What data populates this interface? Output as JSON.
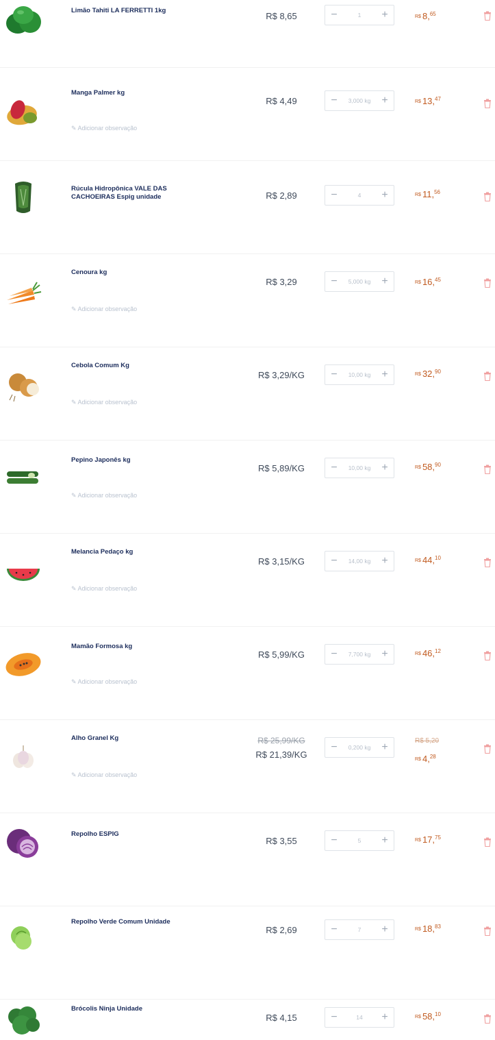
{
  "colors": {
    "accent": "#c15a1f",
    "product_name": "#1b2c5b",
    "muted": "#b9c2cf",
    "trash": "#f0a0a0"
  },
  "note_label": "Adicionar observação",
  "items": [
    {
      "name": "Limão Tahiti LA FERRETTI 1kg",
      "price": "R$ 8,65",
      "qty": "1",
      "total_symbol": "R$",
      "total_int": "8",
      "total_cents": "65",
      "icon": "lime-icon",
      "has_note": false
    },
    {
      "name": "Manga Palmer kg",
      "price": "R$ 4,49",
      "qty": "3,000 kg",
      "total_symbol": "R$",
      "total_int": "13",
      "total_cents": "47",
      "icon": "mango-icon",
      "has_note": true
    },
    {
      "name": "Rúcula Hidropônica VALE DAS CACHOEIRAS Espig unidade",
      "price": "R$ 2,89",
      "qty": "4",
      "total_symbol": "R$",
      "total_int": "11",
      "total_cents": "56",
      "icon": "arugula-icon",
      "has_note": false
    },
    {
      "name": "Cenoura kg",
      "price": "R$ 3,29",
      "qty": "5,000 kg",
      "total_symbol": "R$",
      "total_int": "16",
      "total_cents": "45",
      "icon": "carrot-icon",
      "has_note": true
    },
    {
      "name": "Cebola Comum Kg",
      "price": "R$ 3,29/KG",
      "qty": "10,00 kg",
      "total_symbol": "R$",
      "total_int": "32",
      "total_cents": "90",
      "icon": "onion-icon",
      "has_note": true
    },
    {
      "name": "Pepino Japonês kg",
      "price": "R$ 5,89/KG",
      "qty": "10,00 kg",
      "total_symbol": "R$",
      "total_int": "58",
      "total_cents": "90",
      "icon": "cucumber-icon",
      "has_note": true
    },
    {
      "name": "Melancia Pedaço kg",
      "price": "R$ 3,15/KG",
      "qty": "14,00 kg",
      "total_symbol": "R$",
      "total_int": "44",
      "total_cents": "10",
      "icon": "watermelon-icon",
      "has_note": true
    },
    {
      "name": "Mamão Formosa kg",
      "price": "R$ 5,99/KG",
      "qty": "7,700 kg",
      "total_symbol": "R$",
      "total_int": "46",
      "total_cents": "12",
      "icon": "papaya-icon",
      "has_note": true
    },
    {
      "name": "Alho Granel Kg",
      "old_price": "R$ 25,99/KG",
      "price": "R$ 21,39/KG",
      "qty": "0,200 kg",
      "old_total": "R$ 5,20",
      "total_symbol": "R$",
      "total_int": "4",
      "total_cents": "28",
      "icon": "garlic-icon",
      "has_note": true
    },
    {
      "name": "Repolho ESPIG",
      "price": "R$ 3,55",
      "qty": "5",
      "total_symbol": "R$",
      "total_int": "17",
      "total_cents": "75",
      "icon": "red-cabbage-icon",
      "has_note": false
    },
    {
      "name": "Repolho Verde Comum Unidade",
      "price": "R$ 2,69",
      "qty": "7",
      "total_symbol": "R$",
      "total_int": "18",
      "total_cents": "83",
      "icon": "green-cabbage-icon",
      "has_note": false
    },
    {
      "name": "Brócolis Ninja Unidade",
      "price": "R$ 4,15",
      "qty": "14",
      "total_symbol": "R$",
      "total_int": "58",
      "total_cents": "10",
      "icon": "broccoli-icon",
      "has_note": false
    }
  ]
}
